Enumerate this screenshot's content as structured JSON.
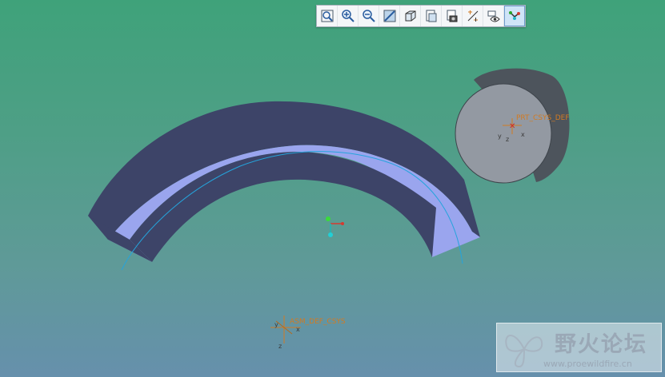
{
  "colors": {
    "background_top": "#3fa27a",
    "background_bottom": "#6690ac",
    "arch_dark": "#3d4468",
    "arch_light": "#9aa5ee",
    "cylinder_face": "#9399a2",
    "cylinder_side": "#4d545c",
    "csys_label": "#d27a22",
    "datum_curve": "#25a4dc"
  },
  "toolbar": {
    "buttons": [
      {
        "name": "zoom-fit-icon",
        "title": "Refit"
      },
      {
        "name": "zoom-in-icon",
        "title": "Zoom In"
      },
      {
        "name": "zoom-out-icon",
        "title": "Zoom Out"
      },
      {
        "name": "repaint-icon",
        "title": "Repaint"
      },
      {
        "name": "display-style-icon",
        "title": "Display Style"
      },
      {
        "name": "saved-views-icon",
        "title": "Saved Views"
      },
      {
        "name": "view-manager-icon",
        "title": "View Manager"
      },
      {
        "name": "datum-display-icon",
        "title": "Datum Display"
      },
      {
        "name": "annotation-display-icon",
        "title": "Annotation Display"
      },
      {
        "name": "spin-center-icon",
        "title": "Spin Center"
      }
    ],
    "active_index": 9
  },
  "scene": {
    "csys_labels": {
      "cylinder": "PRT_CSYS_DEF",
      "assembly": "ASM_DEF_CSYS"
    },
    "axes": {
      "x": "x",
      "y": "y",
      "z": "z"
    }
  },
  "watermark": {
    "title": "野火论坛",
    "url": "www.proewildfire.cn"
  }
}
